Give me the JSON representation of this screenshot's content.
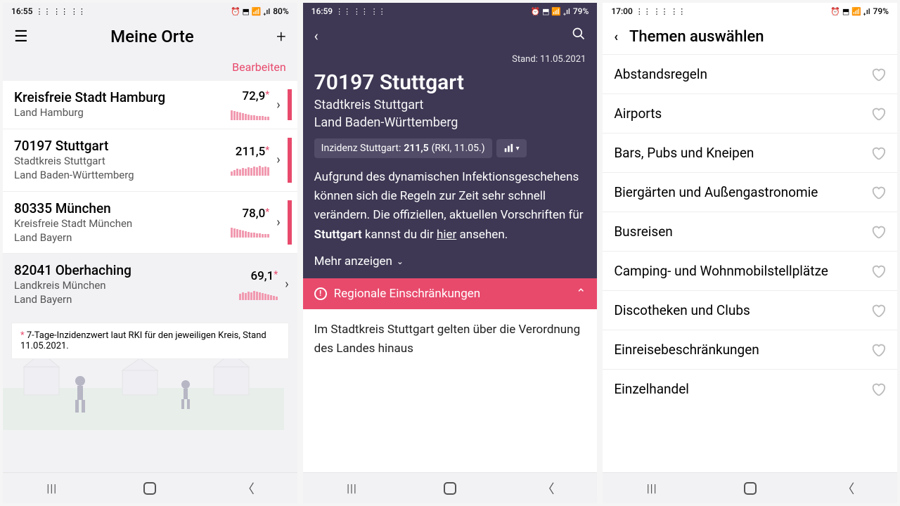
{
  "status": {
    "time1": "16:55",
    "time2": "16:59",
    "time3": "17:00",
    "battery1": "80%",
    "battery2": "79%",
    "battery3": "79%",
    "icons_left": "⋮⋮ ⋮⋮ ⋮⋮",
    "icons_right": "⏰ ⬒ 📶 ₊ıl"
  },
  "screen1": {
    "title": "Meine Orte",
    "edit": "Bearbeiten",
    "footnote_star": "*",
    "footnote": "7-Tage-Inzidenzwert laut RKI für den jeweiligen Kreis, Stand 11.05.2021.",
    "items": [
      {
        "title": "Kreisfreie Stadt Hamburg",
        "sub": "Land Hamburg",
        "value": "72,9",
        "bars": [
          14,
          13,
          12,
          11,
          10,
          9,
          8,
          7,
          7,
          6,
          6,
          6,
          5,
          5
        ],
        "accent": true
      },
      {
        "title": "70197 Stuttgart",
        "sub": "Stadtkreis Stuttgart\nLand Baden-Württemberg",
        "value": "211,5",
        "bars": [
          6,
          8,
          10,
          9,
          11,
          10,
          12,
          11,
          13,
          12,
          14,
          12,
          13,
          12
        ],
        "accent": true
      },
      {
        "title": "80335 München",
        "sub": "Kreisfreie Stadt München\nLand Bayern",
        "value": "78,0",
        "bars": [
          14,
          13,
          12,
          11,
          10,
          9,
          8,
          7,
          7,
          6,
          6,
          5,
          5,
          5
        ],
        "accent": true
      },
      {
        "title": "82041 Oberhaching",
        "sub": "Landkreis München\nLand Bayern",
        "value": "69,1",
        "bars": [
          9,
          11,
          10,
          12,
          11,
          13,
          12,
          11,
          10,
          9,
          8,
          7,
          6,
          5
        ],
        "accent": false
      }
    ]
  },
  "screen2": {
    "stand_label": "Stand: 11.05.2021",
    "title": "70197 Stuttgart",
    "sub1": "Stadtkreis Stuttgart",
    "sub2": "Land Baden-Württemberg",
    "badge_prefix": "Inzidenz Stuttgart: ",
    "badge_value": "211,5",
    "badge_suffix": " (RKI, 11.05.)",
    "chart_icon": "⮹",
    "body_pre": "Aufgrund des dynamischen Infektionsgeschehens können sich die Regeln zur Zeit sehr schnell verändern. Die offiziellen, aktuellen Vorschriften für ",
    "body_bold": "Stuttgart",
    "body_mid": " kannst du dir ",
    "body_link": "hier",
    "body_post": " ansehen.",
    "more": "Mehr anzeigen",
    "section_label": "Regionale Einschränkungen",
    "content": "Im Stadtkreis Stuttgart gelten über die Verordnung des Landes hinaus"
  },
  "screen3": {
    "title": "Themen auswählen",
    "items": [
      "Abstandsregeln",
      "Airports",
      "Bars, Pubs und Kneipen",
      "Biergärten und Außengastronomie",
      "Busreisen",
      "Camping- und Wohnmobilstellplätze",
      "Discotheken und Clubs",
      "Einreisebeschränkungen",
      "Einzelhandel"
    ]
  }
}
